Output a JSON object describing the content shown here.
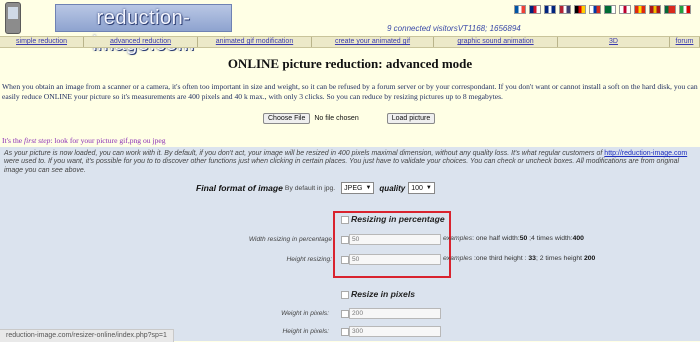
{
  "header": {
    "logo_text": "reduction-image.com",
    "visitors": "9 connected visitorsVT1168; 1656894",
    "flags": [
      {
        "icon": "france-flag-icon",
        "colors": [
          "#0055a4",
          "#ffffff",
          "#ef4135"
        ]
      },
      {
        "icon": "uk-flag-icon",
        "colors": [
          "#00247d",
          "#cf142b",
          "#ffffff"
        ]
      },
      {
        "icon": "australia-flag-icon",
        "colors": [
          "#00247d",
          "#ffffff",
          "#00247d"
        ]
      },
      {
        "icon": "usa-flag-icon",
        "colors": [
          "#b22234",
          "#ffffff",
          "#3c3b6e"
        ]
      },
      {
        "icon": "germany-flag-icon",
        "colors": [
          "#000000",
          "#dd0000",
          "#ffce00"
        ]
      },
      {
        "icon": "russia-flag-icon",
        "colors": [
          "#ffffff",
          "#0039a6",
          "#d52b1e"
        ]
      },
      {
        "icon": "saudi-arabia-flag-icon",
        "colors": [
          "#006c35",
          "#006c35",
          "#ffffff"
        ]
      },
      {
        "icon": "japan-flag-icon",
        "colors": [
          "#ffffff",
          "#bc002d",
          "#ffffff"
        ]
      },
      {
        "icon": "china-flag-icon",
        "colors": [
          "#de2910",
          "#ffde00",
          "#de2910"
        ]
      },
      {
        "icon": "spain-flag-icon",
        "colors": [
          "#aa151b",
          "#f1bf00",
          "#aa151b"
        ]
      },
      {
        "icon": "portugal-flag-icon",
        "colors": [
          "#046a38",
          "#da291c",
          "#da291c"
        ]
      },
      {
        "icon": "iran-flag-icon",
        "colors": [
          "#239f40",
          "#ffffff",
          "#da0000"
        ]
      }
    ]
  },
  "nav": [
    {
      "label": "simple reduction",
      "w": 84
    },
    {
      "label": "advanced reduction",
      "w": 114
    },
    {
      "label": "animated gif modification",
      "w": 114
    },
    {
      "label": "create your animated gif",
      "w": 122
    },
    {
      "label": "graphic sound animation",
      "w": 124
    },
    {
      "label": "3D",
      "w": 112
    },
    {
      "label": "forum",
      "w": 30
    }
  ],
  "main": {
    "title": "ONLINE picture reduction: advanced mode",
    "intro": "When you obtain an image from a scanner or a camera, it's often too important in size and weight, so it can be refused by a forum server or by your correspondant. If you don't want or cannot install a soft on the hard disk, you can easily reduce ONLINE your picture so it's measurements are 400 pixels and 40 k max., with only 3 clicks. So you can reduce by resizing pictures up to 8 megabytes.",
    "choose_file": "Choose File",
    "no_file": "No file chosen",
    "load_picture": "Load picture",
    "first_step_prefix": "It's the ",
    "first_step_em": "first step",
    "first_step_suffix": ": look for your picture gif,png ou jpeg"
  },
  "panel": {
    "note_before_link": "As your picture is now loaded, you can work with it. By default, if you don't act, your image will be resized in 400 pixels maximal dimension, without any quality loss. It's what regular customers of ",
    "note_link": "http://reduction-image.com",
    "note_after_link": " were used to. If you want, it's possible for you to to discover other functions just when clicking in certain places. You just have to validate your choices. You can check or uncheck boxes. All modifications are from original image you can see above.",
    "format_label": "Final format of image",
    "format_sub": "By default in jpg.",
    "format_value": "JPEG",
    "quality_label": "quality",
    "quality_value": "100",
    "resize_pct_title": "Resizing in percentage",
    "width_pct_label": "Width resizing in percentage",
    "width_pct_value": "50",
    "width_pct_example_i": "examples",
    "width_pct_example_a": ": one half width:",
    "width_pct_example_b": "50",
    "width_pct_example_c": " ;4 times width:",
    "width_pct_example_d": "400",
    "height_label": "Height resizing:",
    "height_value": "50",
    "height_example_i": "examples",
    "height_example_a": " :one third height : ",
    "height_example_b": "33",
    "height_example_c": "; 2 times height ",
    "height_example_d": "200",
    "resize_px_title": "Resize in pixels",
    "weight_px_label": "Weight in pixels:",
    "weight_px_value": "200",
    "height_px_label": "Height in pixels:",
    "height_px_value": "300"
  },
  "status_bar": "reduction-image.com/resizer-online/index.php?sp=1"
}
